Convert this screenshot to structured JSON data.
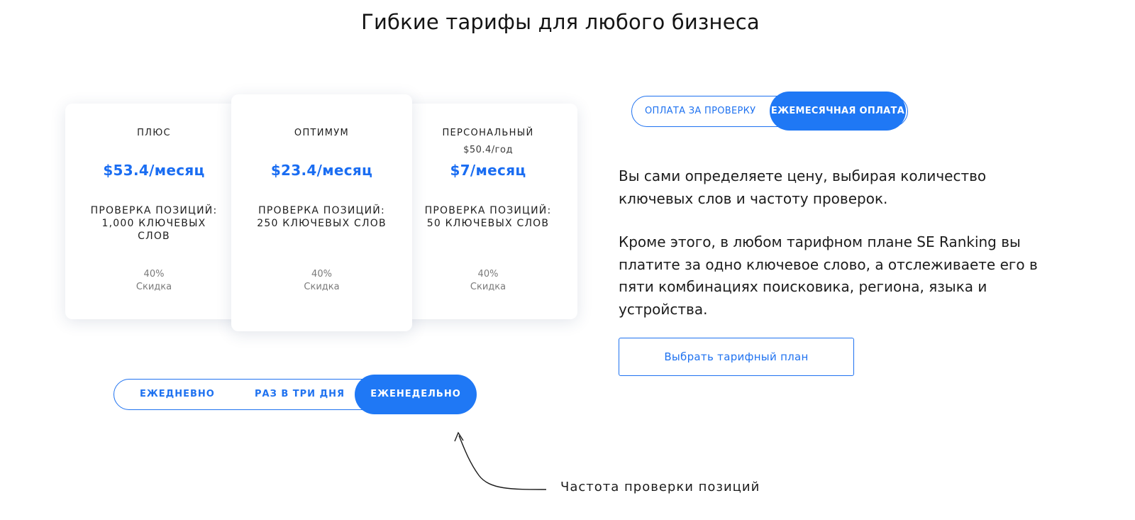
{
  "page": {
    "title": "Гибкие тарифы для любого бизнеса"
  },
  "plans": {
    "plus": {
      "name": "ПЛЮС",
      "price": "$53.4/месяц",
      "feature": "ПРОВЕРКА ПОЗИЦИЙ: 1,000 КЛЮЧЕВЫХ СЛОВ",
      "discount_value": "40%",
      "discount_label": "Скидка"
    },
    "optimum": {
      "name": "ОПТИМУМ",
      "price": "$23.4/месяц",
      "feature": "ПРОВЕРКА ПОЗИЦИЙ: 250 КЛЮЧЕВЫХ СЛОВ",
      "discount_value": "40%",
      "discount_label": "Скидка"
    },
    "personal": {
      "name": "ПЕРСОНАЛЬНЫЙ",
      "yearly": "$50.4/год",
      "price": "$7/месяц",
      "feature": "ПРОВЕРКА ПОЗИЦИЙ: 50 КЛЮЧЕВЫХ СЛОВ",
      "discount_value": "40%",
      "discount_label": "Скидка"
    }
  },
  "frequency": {
    "daily": "ЕЖЕДНЕВНО",
    "every_three_days": "РАЗ В ТРИ ДНЯ",
    "weekly": "ЕЖЕНЕДЕЛЬНО",
    "selected": "ЕЖЕНЕДЕЛЬНО"
  },
  "payment": {
    "per_check": "ОПЛАТА ЗА ПРОВЕРКУ",
    "monthly": "ЕЖЕМЕСЯЧНАЯ ОПЛАТА",
    "selected": "ЕЖЕМЕСЯЧНАЯ ОПЛАТА"
  },
  "description": {
    "p1": "Вы сами определяете цену, выбирая количество ключевых слов и частоту проверок.",
    "p2": "Кроме этого, в любом тарифном плане SE Ranking вы платите за одно ключевое слово, а отслеживаете его в пяти комбинациях поисковика, региона, языка и устройства."
  },
  "cta": {
    "choose_plan": "Выбрать тарифный план"
  },
  "annotation": {
    "text": "Частота проверки позиций",
    "icon": "curved-arrow-icon"
  },
  "colors": {
    "accent": "#1f78f5",
    "price": "#1a6df2",
    "text": "#1c1c1c",
    "muted": "#7a7a7a"
  }
}
